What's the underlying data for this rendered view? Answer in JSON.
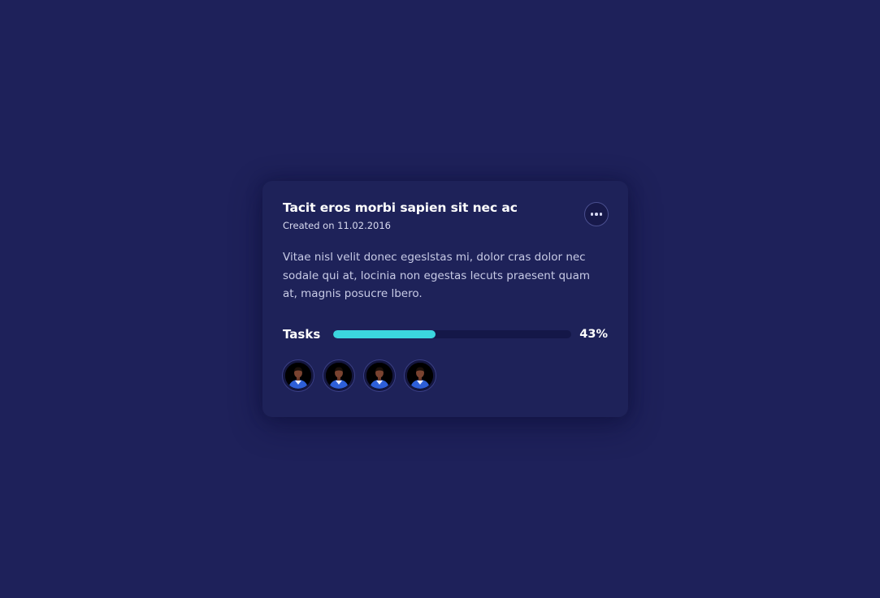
{
  "card": {
    "title": "Tacit eros morbi sapien sit nec ac",
    "created": "Created on 11.02.2016",
    "description": "Vitae nisl velit donec egeslstas mi, dolor cras dolor nec sodale qui at, locinia non egestas lecuts praesent quam at, magnis posucre lbero.",
    "menu_icon": "more-horizontal-icon"
  },
  "tasks": {
    "label": "Tasks",
    "progress": 0.43,
    "percent_label": "43%",
    "bar_color": "#3bd6df",
    "track_color": "#141748"
  },
  "members": [
    {
      "icon": "avatar-photo"
    },
    {
      "icon": "avatar-photo"
    },
    {
      "icon": "avatar-photo"
    },
    {
      "icon": "avatar-photo"
    }
  ],
  "colors": {
    "background": "#1e215a",
    "card": "#1e2259",
    "accent": "#3bd6df"
  }
}
